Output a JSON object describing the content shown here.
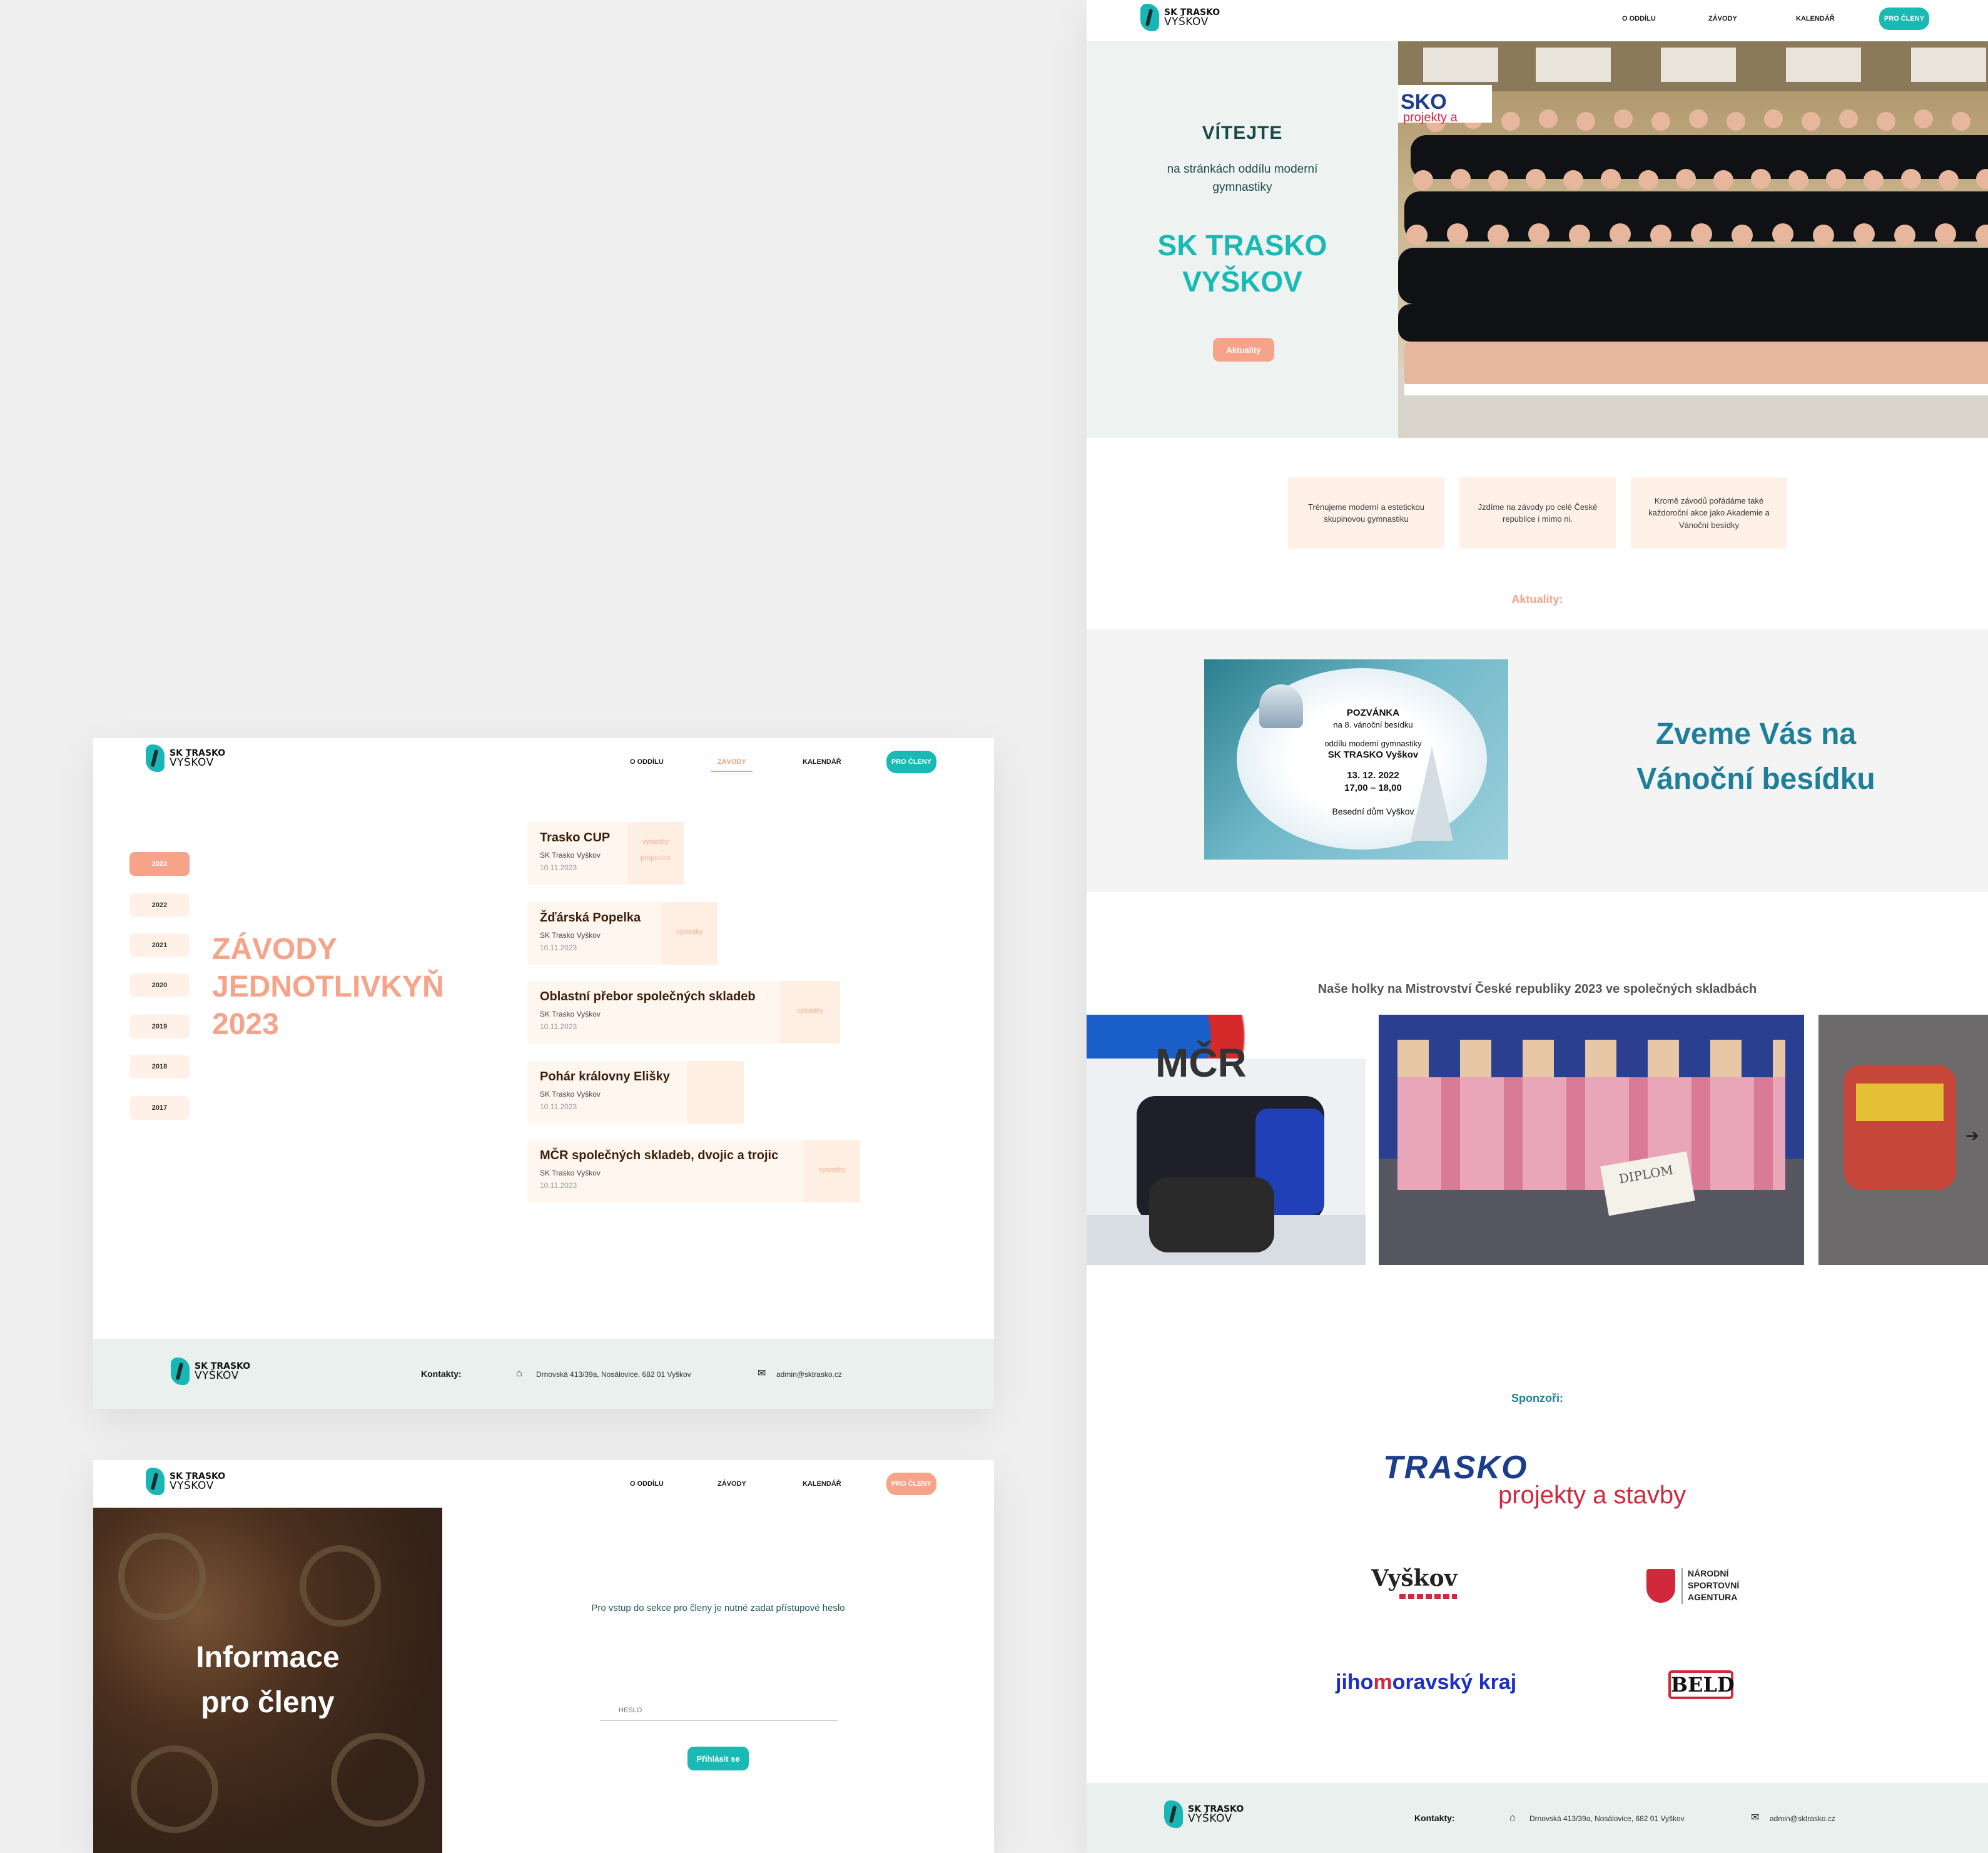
{
  "brand": {
    "line1": "SK TRASKO",
    "line2": "VYŠKOV"
  },
  "nav": {
    "o_oddilu": "O ODDÍLU",
    "zavody": "ZÁVODY",
    "kalendar": "KALENDÁŘ",
    "pro_cleny": "PRO ČLENY"
  },
  "colors": {
    "teal": "#19b9b4",
    "salmon": "#f6a389",
    "heading_teal": "#1e7f9a"
  },
  "home": {
    "welcome": "VÍTEJTE",
    "subtitle": "na stránkách oddílu moderní gymnastiky",
    "club_name_line1": "SK TRASKO",
    "club_name_line2": "VYŠKOV",
    "news_button": "Aktuality",
    "photo_banner_text": "SKO",
    "photo_banner_sub": "projekty a",
    "social": [
      "facebook-icon",
      "instagram-icon"
    ],
    "cards": [
      "Trénujeme moderní a estetickou skupinovou gymnastiku",
      "Jzdíme na závody po celé České republice i mimo ni.",
      "Kromě závodů pořádáme také každoroční akce jako Akademie a Vánoční besídky"
    ],
    "news_label": "Aktuality:",
    "invitation": {
      "title": "POZVÁNKA",
      "line2": "na 8. vánoční besídku",
      "line3": "oddílu moderní gymnastiky",
      "line4": "SK TRASKO Vyškov",
      "date": "13. 12. 2022",
      "time": "17,00 – 18,00",
      "place": "Besední dům Vyškov"
    },
    "news_headline_1": "Zveme Vás na",
    "news_headline_2": "Vánoční besídku",
    "gallery_title": "Naše holky na Mistrovství České republiky 2023 ve společných skladbách",
    "gallery_banner": "MČR",
    "gallery_diploma": "DIPLOM",
    "sponsors_label": "Sponzoři:",
    "sponsors": {
      "trasko": "TRASKO",
      "trasko_sub": "projekty a stavby",
      "vyskov": "Vyškov",
      "nsa_line1": "NÁRODNÍ",
      "nsa_line2": "SPORTOVNÍ",
      "nsa_line3": "AGENTURA",
      "jmk_a": "jiho",
      "jmk_b": "m",
      "jmk_c": "oravský kraj",
      "beld": "BELD"
    }
  },
  "competitions": {
    "years": [
      "2023",
      "2022",
      "2021",
      "2020",
      "2019",
      "2018",
      "2017"
    ],
    "title_line1": "ZÁVODY",
    "title_line2": "JEDNOTLIVKYŇ",
    "title_line3": "2023",
    "items": [
      {
        "name": "Trasko CUP",
        "org": "SK Trasko Vyškov",
        "date": "10.11.2023",
        "link1": "výsledky",
        "link2": "propozice"
      },
      {
        "name": "Žďárská Popelka",
        "org": "SK Trasko Vyškov",
        "date": "10.11.2023",
        "link1": "výsledky",
        "link2": ""
      },
      {
        "name": "Oblastní přebor společných skladeb",
        "org": "SK Trasko Vyškov",
        "date": "10.11.2023",
        "link1": "výsledky",
        "link2": ""
      },
      {
        "name": "Pohár královny Elišky",
        "org": "SK Trasko Vyškov",
        "date": "10.11.2023",
        "link1": "",
        "link2": ""
      },
      {
        "name": "MČR společných skladeb, dvojic a trojic",
        "org": "SK Trasko Vyškov",
        "date": "10.11.2023",
        "link1": "výsledky",
        "link2": ""
      }
    ]
  },
  "members": {
    "hero_line1": "Informace",
    "hero_line2": "pro členy",
    "prompt": "Pro vstup do sekce pro členy je nutné zadat přístupové heslo",
    "password_placeholder": "HESLO",
    "login_button": "Přihlásit se"
  },
  "footer": {
    "contacts_label": "Kontakty:",
    "address": "Drnovská 413/39a, Nosálovice, 682 01 Vyškov",
    "email": "admin@sktrasko.cz"
  }
}
